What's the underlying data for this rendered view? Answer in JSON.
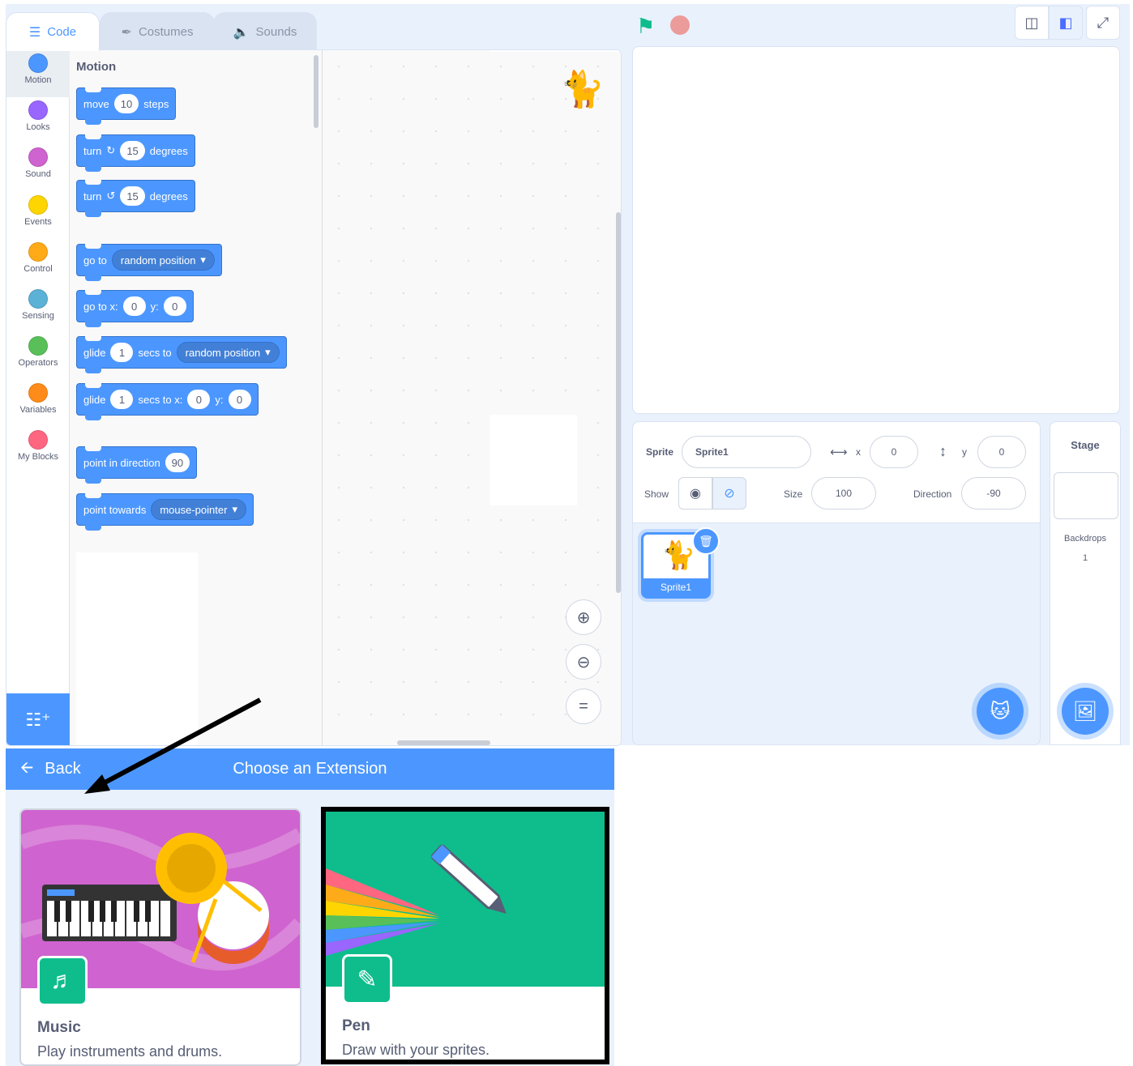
{
  "tabs": [
    {
      "label": "Code",
      "icon": "code-icon"
    },
    {
      "label": "Costumes",
      "icon": "brush-icon"
    },
    {
      "label": "Sounds",
      "icon": "speaker-icon"
    }
  ],
  "categories": [
    {
      "label": "Motion",
      "color": "#4c97ff"
    },
    {
      "label": "Looks",
      "color": "#9966ff"
    },
    {
      "label": "Sound",
      "color": "#cf63cf"
    },
    {
      "label": "Events",
      "color": "#ffd500"
    },
    {
      "label": "Control",
      "color": "#ffab19"
    },
    {
      "label": "Sensing",
      "color": "#5cb1d6"
    },
    {
      "label": "Operators",
      "color": "#59c059"
    },
    {
      "label": "Variables",
      "color": "#ff8c1a"
    },
    {
      "label": "My Blocks",
      "color": "#ff6680"
    }
  ],
  "palette": {
    "title": "Motion",
    "blocks": {
      "move": {
        "t1": "move",
        "v1": "10",
        "t2": "steps"
      },
      "turn_right": {
        "t1": "turn",
        "v1": "15",
        "t2": "degrees"
      },
      "turn_left": {
        "t1": "turn",
        "v1": "15",
        "t2": "degrees"
      },
      "goto": {
        "t1": "go to",
        "d1": "random position"
      },
      "gotoxy": {
        "t1": "go to x:",
        "v1": "0",
        "t2": "y:",
        "v2": "0"
      },
      "glide_to": {
        "t1": "glide",
        "v1": "1",
        "t2": "secs to",
        "d1": "random position"
      },
      "glide_xy": {
        "t1": "glide",
        "v1": "1",
        "t2": "secs to x:",
        "v2": "0",
        "t3": "y:",
        "v3": "0"
      },
      "point_dir": {
        "t1": "point in direction",
        "v1": "90"
      },
      "point_towards": {
        "t1": "point towards",
        "d1": "mouse-pointer"
      }
    }
  },
  "sprite_info": {
    "sprite_label": "Sprite",
    "sprite_name": "Sprite1",
    "x_label": "x",
    "x_value": "0",
    "y_label": "y",
    "y_value": "0",
    "show_label": "Show",
    "size_label": "Size",
    "size_value": "100",
    "direction_label": "Direction",
    "direction_value": "-90"
  },
  "sprites": [
    {
      "name": "Sprite1"
    }
  ],
  "stage_pane": {
    "title": "Stage",
    "backdrops_label": "Backdrops",
    "backdrops_count": "1"
  },
  "extension_library": {
    "back_label": "Back",
    "title": "Choose an Extension",
    "cards": [
      {
        "name": "Music",
        "description": "Play instruments and drums.",
        "color": "#cf63cf"
      },
      {
        "name": "Pen",
        "description": "Draw with your sprites.",
        "color": "#0fbd8c"
      }
    ]
  }
}
